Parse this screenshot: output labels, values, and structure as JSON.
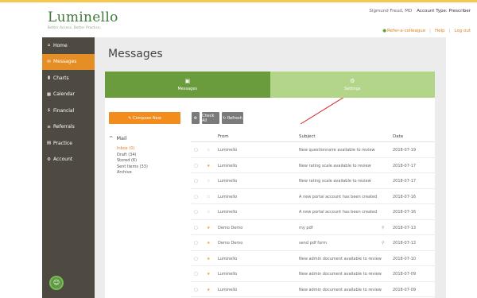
{
  "header": {
    "logo_name": "Luminello",
    "logo_tagline": "Better Access. Better Practice.",
    "user_name": "Sigmund Freud, MD",
    "account_type_label": "Account Type: Prescriber",
    "links": {
      "refer": "Refer-a-colleague",
      "help": "Help",
      "logout": "Log out"
    }
  },
  "sidebar": {
    "items": [
      {
        "icon": "home-icon",
        "glyph": "⌂",
        "label": "Home"
      },
      {
        "icon": "envelope-icon",
        "glyph": "✉",
        "label": "Messages"
      },
      {
        "icon": "chart-icon",
        "glyph": "▮",
        "label": "Charts"
      },
      {
        "icon": "calendar-icon",
        "glyph": "▦",
        "label": "Calendar"
      },
      {
        "icon": "dollar-icon",
        "glyph": "$",
        "label": "Financial"
      },
      {
        "icon": "list-icon",
        "glyph": "≡",
        "label": "Referrals"
      },
      {
        "icon": "building-icon",
        "glyph": "▤",
        "label": "Practice"
      },
      {
        "icon": "gear-icon",
        "glyph": "⚙",
        "label": "Account"
      }
    ],
    "active_index": 1
  },
  "main": {
    "title": "Messages",
    "tabs": [
      {
        "label": "Messages",
        "icon": "inbox-icon",
        "glyph": "▣"
      },
      {
        "label": "Settings",
        "icon": "gears-icon",
        "glyph": "⚙"
      }
    ],
    "toolbar": {
      "compose_label": "Compose New",
      "check_all_label": "Check All",
      "refresh_label": "Refresh"
    },
    "mail": {
      "heading": "Mail",
      "folders": [
        "Inbox (0)",
        "Draft (34)",
        "Stored (6)",
        "Sent Items (33)",
        "Archive"
      ]
    },
    "table": {
      "columns": [
        "From",
        "Subject",
        "Date"
      ],
      "rows": [
        {
          "starred": false,
          "from": "Luminello",
          "subject": "New questionnaire available to review",
          "attachment": false,
          "date": "2018-07-19"
        },
        {
          "starred": true,
          "from": "Luminello",
          "subject": "New rating scale available to review",
          "attachment": false,
          "date": "2018-07-17"
        },
        {
          "starred": false,
          "from": "Luminello",
          "subject": "New rating scale available to review",
          "attachment": false,
          "date": "2018-07-17"
        },
        {
          "starred": false,
          "from": "Luminello",
          "subject": "A new portal account has been created",
          "attachment": false,
          "date": "2018-07-16"
        },
        {
          "starred": false,
          "from": "Luminello",
          "subject": "A new portal account has been created",
          "attachment": false,
          "date": "2018-07-16"
        },
        {
          "starred": true,
          "from": "Demo Demo",
          "subject": "my pdf",
          "attachment": true,
          "date": "2018-07-13"
        },
        {
          "starred": true,
          "from": "Demo Demo",
          "subject": "send pdf form",
          "attachment": true,
          "date": "2018-07-13"
        },
        {
          "starred": true,
          "from": "Luminello",
          "subject": "New admin document available to review",
          "attachment": false,
          "date": "2018-07-10"
        },
        {
          "starred": true,
          "from": "Luminello",
          "subject": "New admin document available to review",
          "attachment": false,
          "date": "2018-07-09"
        },
        {
          "starred": true,
          "from": "Luminello",
          "subject": "New admin document available to review",
          "attachment": false,
          "date": "2018-07-09"
        }
      ]
    }
  },
  "colors": {
    "brand_green": "#6a9c3d",
    "tab_light_green": "#b3d58a",
    "accent_orange": "#f28c1c",
    "sidebar_bg": "#4e4a42",
    "annotation_red": "#e02020"
  }
}
